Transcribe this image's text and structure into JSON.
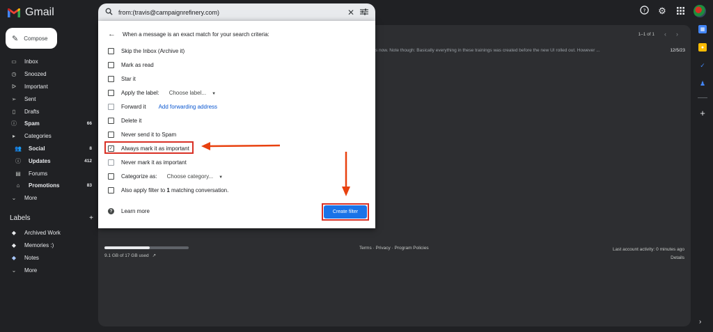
{
  "app": {
    "name": "Gmail"
  },
  "search": {
    "query": "from:(travis@campaignrefinery.com)"
  },
  "compose": {
    "label": "Compose"
  },
  "nav": [
    {
      "icon": "inbox-icon",
      "glyph": "▭",
      "label": "Inbox",
      "count": ""
    },
    {
      "icon": "snooze-icon",
      "glyph": "◷",
      "label": "Snoozed",
      "count": ""
    },
    {
      "icon": "important-icon",
      "glyph": "ᐅ",
      "label": "Important",
      "count": ""
    },
    {
      "icon": "sent-icon",
      "glyph": "➢",
      "label": "Sent",
      "count": ""
    },
    {
      "icon": "drafts-icon",
      "glyph": "▯",
      "label": "Drafts",
      "count": ""
    },
    {
      "icon": "spam-icon",
      "glyph": "ⓘ",
      "label": "Spam",
      "count": "66"
    },
    {
      "icon": "categories-icon",
      "glyph": "▸",
      "label": "Categories",
      "count": ""
    },
    {
      "icon": "social-icon",
      "glyph": "👥",
      "label": "Social",
      "count": "8"
    },
    {
      "icon": "updates-icon",
      "glyph": "ⓘ",
      "label": "Updates",
      "count": "412"
    },
    {
      "icon": "forums-icon",
      "glyph": "▤",
      "label": "Forums",
      "count": ""
    },
    {
      "icon": "promotions-icon",
      "glyph": "⌂",
      "label": "Promotions",
      "count": "83"
    },
    {
      "icon": "more-icon",
      "glyph": "⌄",
      "label": "More",
      "count": ""
    }
  ],
  "labels_section": {
    "title": "Labels",
    "add": "+",
    "items": [
      {
        "label": "Archived Work",
        "color": "#e8eaed"
      },
      {
        "label": "Memories :)",
        "color": "#e8eaed"
      },
      {
        "label": "Notes",
        "color": "#a8c7fa"
      },
      {
        "label": "More",
        "color": ""
      }
    ]
  },
  "main": {
    "pager": "1–1 of 1",
    "snippet": "s now. Note though: Basically everything in these trainings was created before the new UI rolled out. However ...",
    "date": "12/5/23",
    "storage": {
      "text": "9.1 GB of 17 GB used",
      "fraction": 0.535
    },
    "footer_links": "Terms · Privacy · Program Policies",
    "last_activity": "Last account activity: 0 minutes ago",
    "details": "Details"
  },
  "dialog": {
    "heading": "When a message is an exact match for your search criteria:",
    "options": [
      {
        "label": "Skip the Inbox (Archive it)",
        "checked": false,
        "light": false
      },
      {
        "label": "Mark as read",
        "checked": false,
        "light": false
      },
      {
        "label": "Star it",
        "checked": false,
        "light": false
      },
      {
        "label": "Apply the label:",
        "checked": false,
        "light": false,
        "dropdown": "Choose label..."
      },
      {
        "label": "Forward it",
        "checked": false,
        "light": true,
        "link": "Add forwarding address"
      },
      {
        "label": "Delete it",
        "checked": false,
        "light": false
      },
      {
        "label": "Never send it to Spam",
        "checked": false,
        "light": false
      },
      {
        "label": "Always mark it as important",
        "checked": true,
        "light": false
      },
      {
        "label": "Never mark it as important",
        "checked": false,
        "light": true
      },
      {
        "label": "Categorize as:",
        "checked": false,
        "light": false,
        "dropdown": "Choose category..."
      },
      {
        "label_pre": "Also apply filter to ",
        "label_bold": "1",
        "label_post": " matching conversation.",
        "checked": false,
        "light": false
      }
    ],
    "learn_more": "Learn more",
    "create_button": "Create filter",
    "accent": "#1a73e8",
    "highlight_color": "#d93025"
  }
}
